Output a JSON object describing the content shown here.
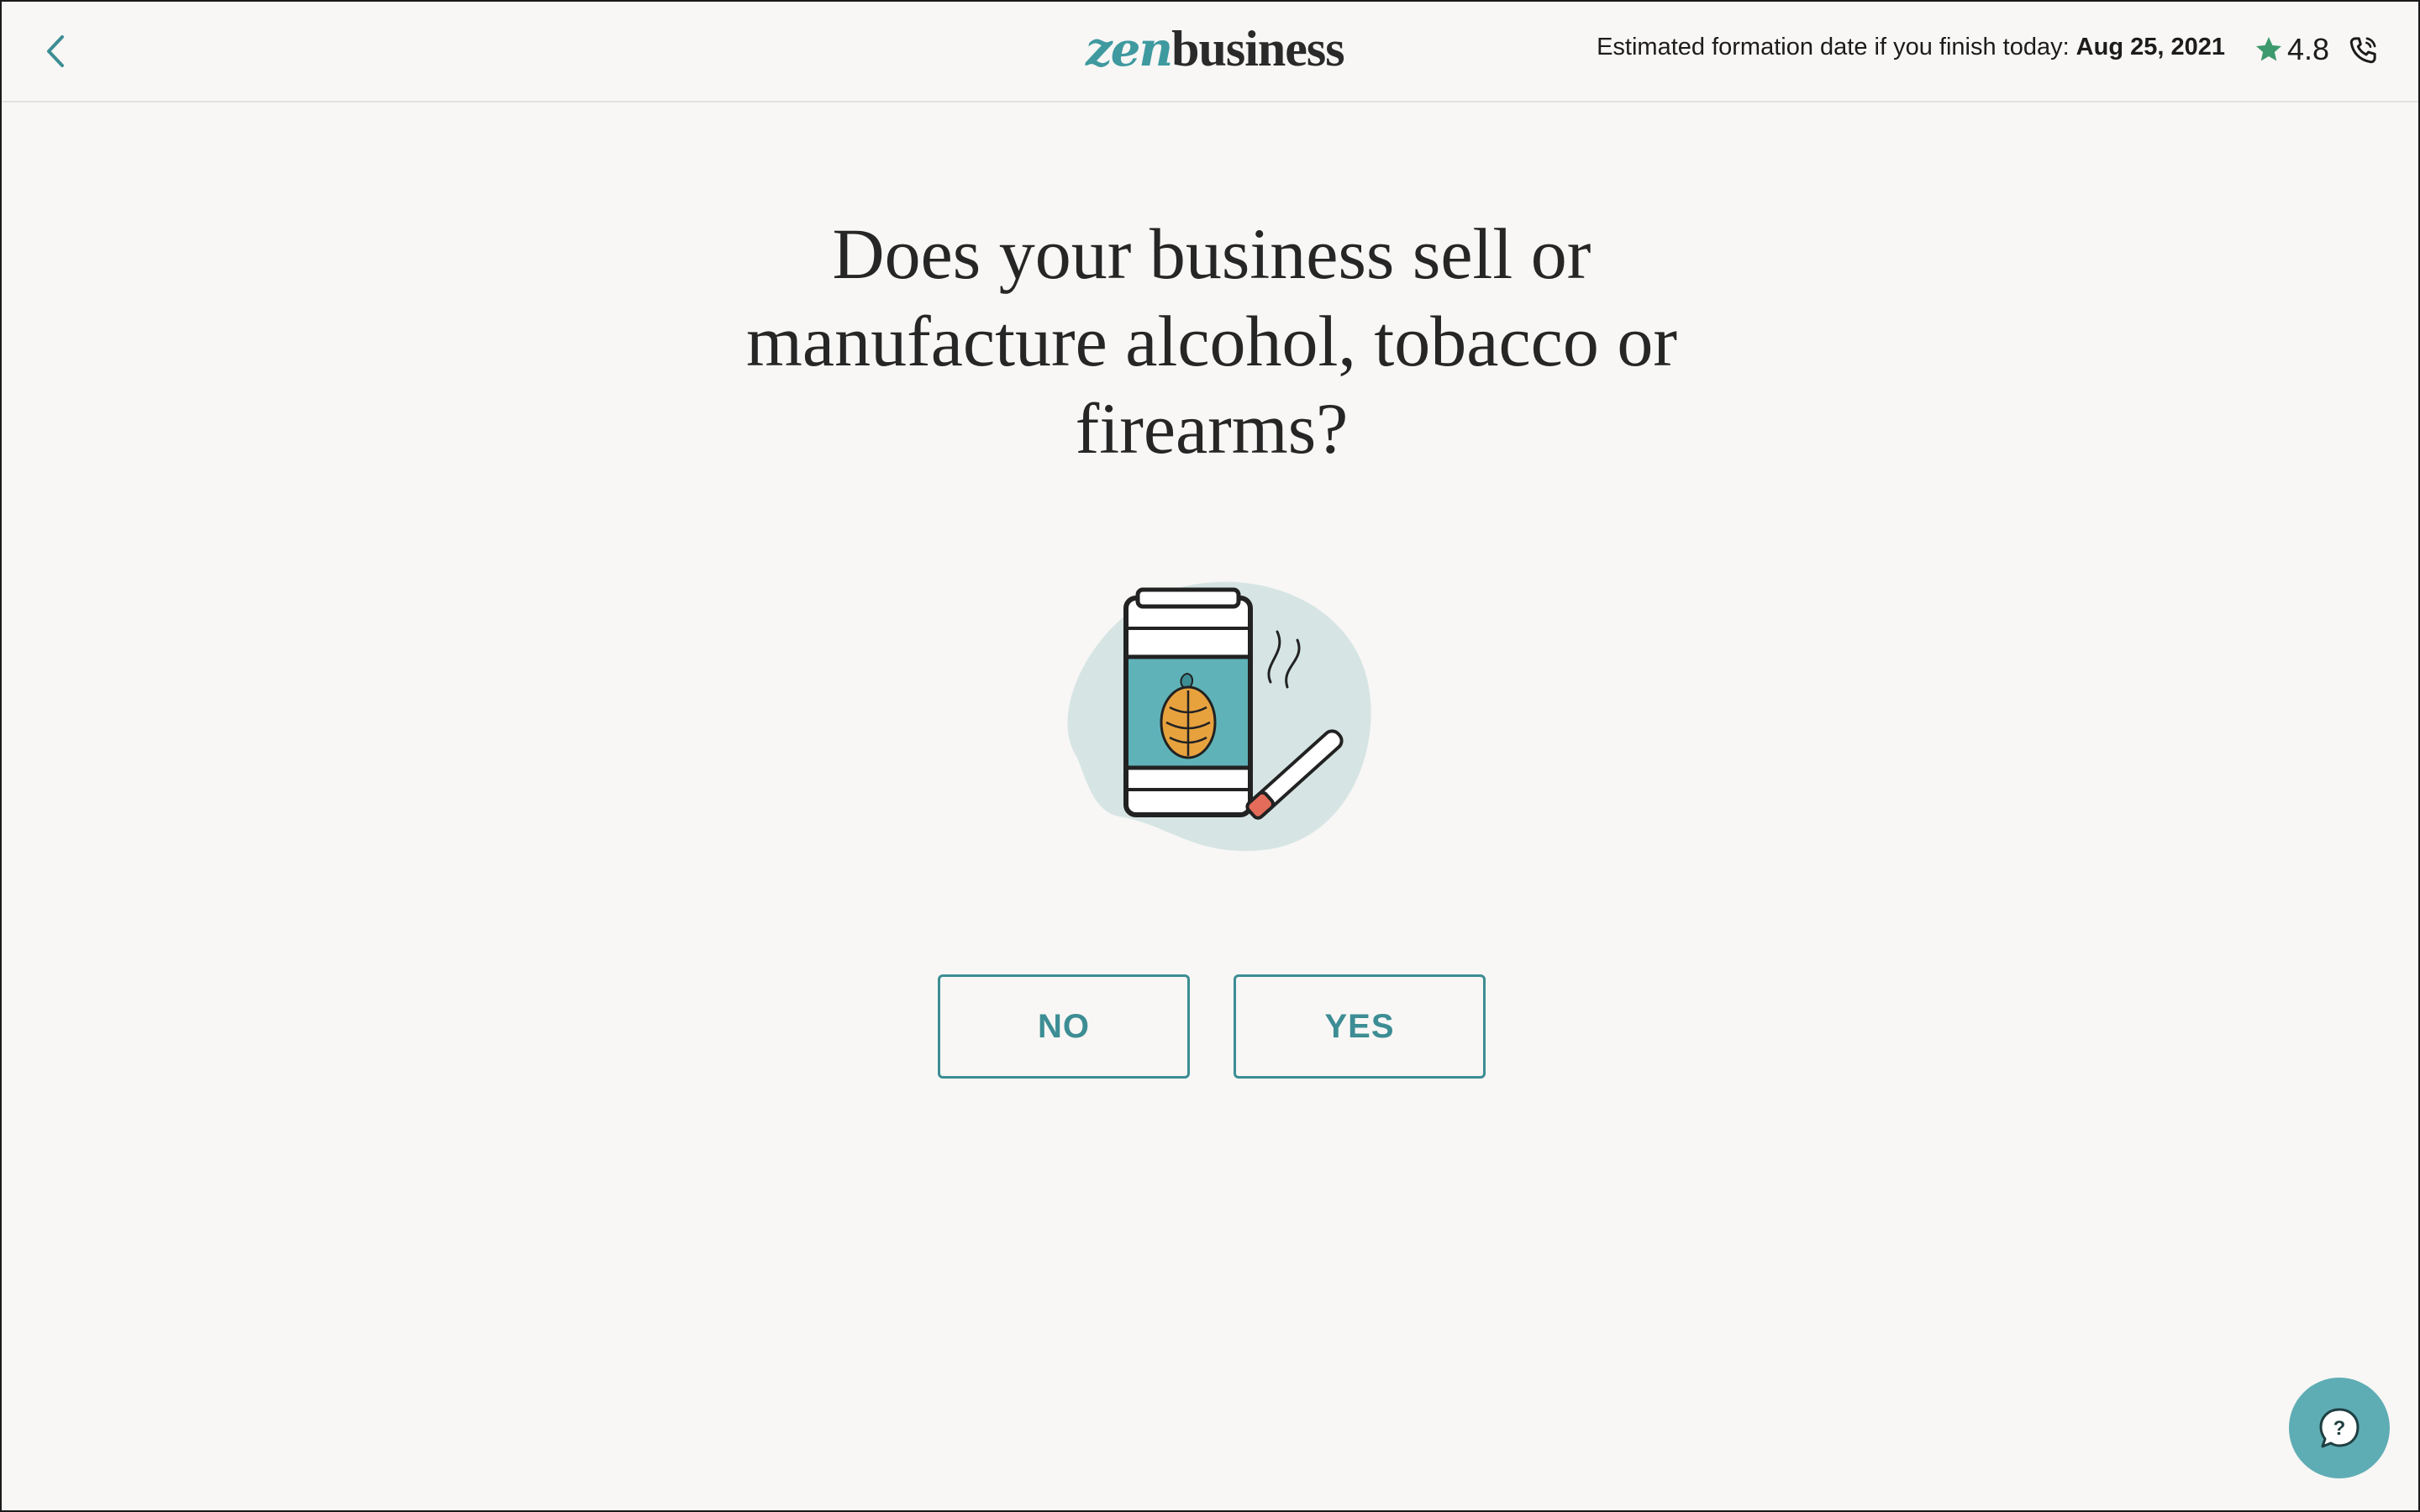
{
  "header": {
    "logo_zen": "zen",
    "logo_business": "business",
    "estimate_label": "Estimated formation date if you finish today:",
    "estimate_date": "Aug 25, 2021",
    "rating": "4.8",
    "icons": {
      "back": "chevron-left-icon",
      "star": "star-icon",
      "phone": "phone-icon"
    }
  },
  "main": {
    "question_lines": [
      "Does your business sell or",
      "manufacture alcohol, tobacco or",
      "firearms?"
    ],
    "buttons": {
      "no": "NO",
      "yes": "YES"
    },
    "illustration": "beer-can-and-cigarette-illustration"
  },
  "help": {
    "icon": "help-chat-icon",
    "glyph": "?"
  },
  "colors": {
    "accent": "#3d8d94",
    "brand_teal": "#3f9aa0",
    "star": "#3d9a6e",
    "background": "#f8f7f5",
    "help_bubble": "#5fadb4",
    "blob": "#d6e5e4"
  }
}
